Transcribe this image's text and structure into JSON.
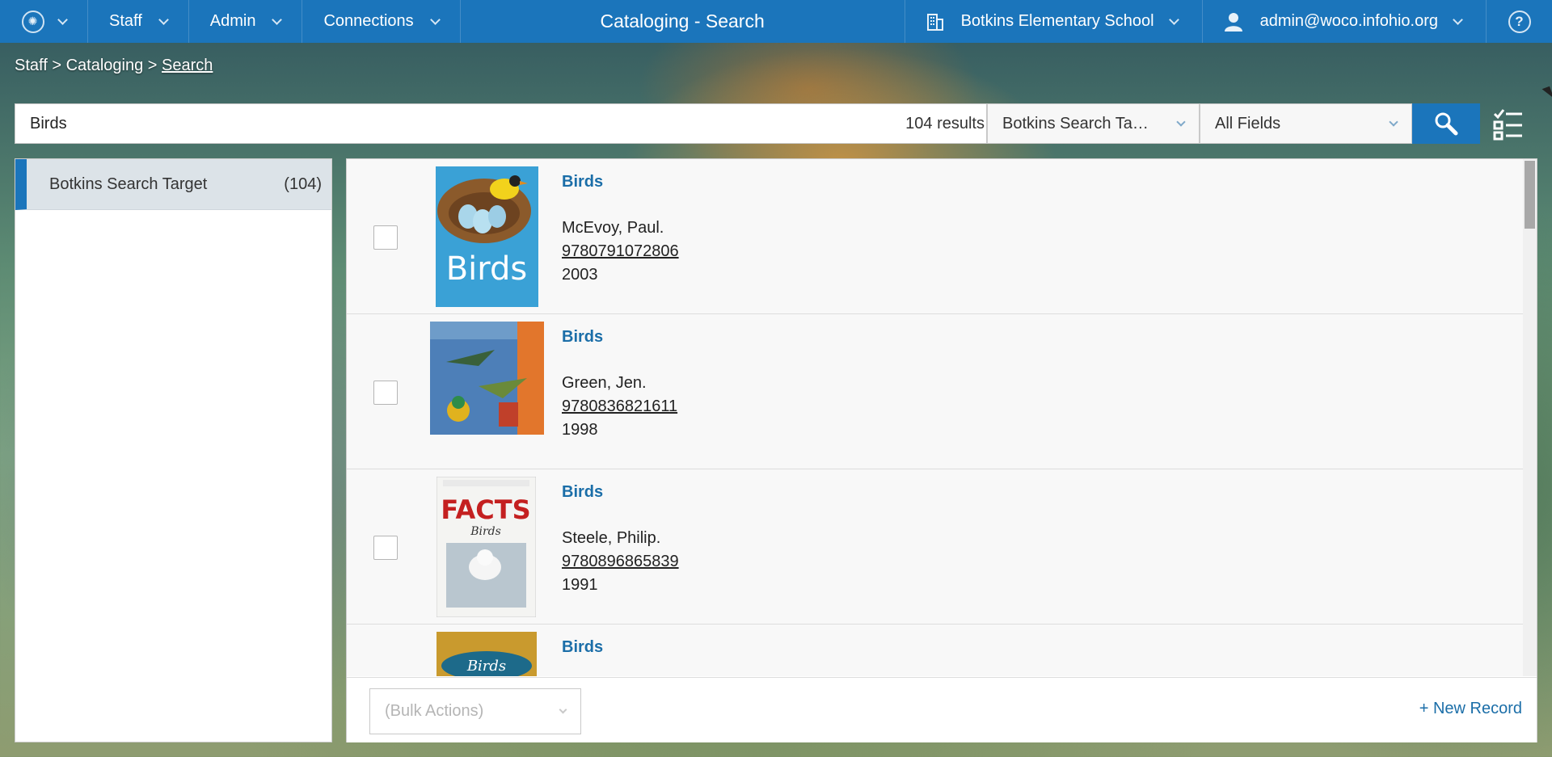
{
  "topbar": {
    "logo_icon": "district-logo-icon",
    "menus": [
      "Staff",
      "Admin",
      "Connections"
    ],
    "title": "Cataloging - Search",
    "school": "Botkins Elementary School",
    "user": "admin@woco.infohio.org",
    "help_glyph": "?"
  },
  "breadcrumb": {
    "part1": "Staff",
    "sep": ">",
    "part2": "Cataloging",
    "current": "Search"
  },
  "search": {
    "query": "Birds",
    "result_count": "104 results",
    "target": "Botkins Search Ta…",
    "field": "All Fields"
  },
  "targets": [
    {
      "label": "Botkins Search Target",
      "count": "(104)"
    }
  ],
  "results": [
    {
      "title": "Birds",
      "author": "McEvoy, Paul.",
      "isbn": "9780791072806",
      "year": "2003"
    },
    {
      "title": "Birds",
      "author": "Green, Jen.",
      "isbn": "9780836821611",
      "year": "1998"
    },
    {
      "title": "Birds",
      "author": "Steele, Philip.",
      "isbn": "9780896865839",
      "year": "1991"
    },
    {
      "title": "Birds",
      "author": "",
      "isbn": "",
      "year": ""
    }
  ],
  "cover_texts": [
    "Birds",
    "FACTS",
    "Birds",
    "Birds"
  ],
  "footer": {
    "bulk_placeholder": "(Bulk Actions)",
    "new_record": "+ New Record"
  },
  "colors": {
    "brand": "#1b75bb",
    "link": "#1b6ea8"
  }
}
